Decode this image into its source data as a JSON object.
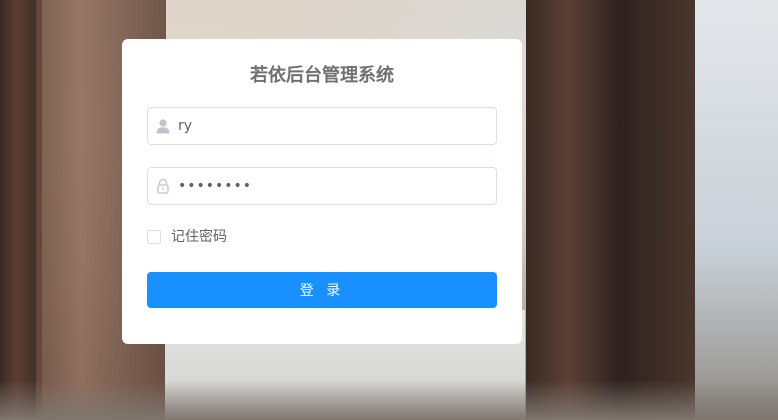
{
  "login": {
    "title": "若依后台管理系统",
    "username_value": "ry",
    "password_value": "••••••••",
    "remember_label": "记住密码",
    "remember_checked": false,
    "submit_label": "登 录"
  },
  "colors": {
    "primary": "#1890ff",
    "border": "#dcdfe6",
    "title_text": "#707070",
    "body_text": "#606266"
  },
  "icons": {
    "username": "user-icon",
    "password": "lock-icon"
  }
}
